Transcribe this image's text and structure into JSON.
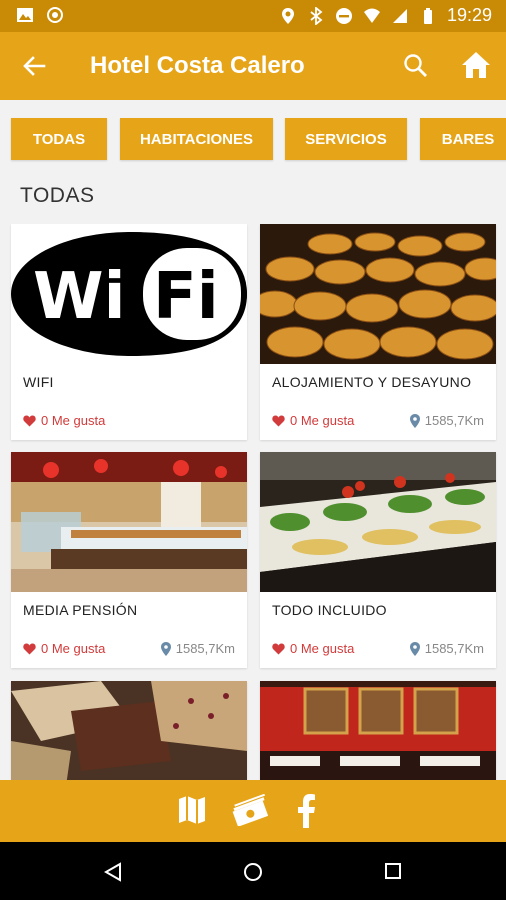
{
  "status_bar": {
    "time": "19:29"
  },
  "app_bar": {
    "title": "Hotel Costa Calero"
  },
  "tabs": [
    {
      "label": "TODAS"
    },
    {
      "label": "HABITACIONES"
    },
    {
      "label": "SERVICIOS"
    },
    {
      "label": "BARES"
    }
  ],
  "section": {
    "title": "TODAS"
  },
  "cards": [
    {
      "name": "WIFI",
      "likes": "0 Me gusta",
      "distance": ""
    },
    {
      "name": "ALOJAMIENTO Y DESAYUNO",
      "likes": "0 Me gusta",
      "distance": "1585,7Km"
    },
    {
      "name": "MEDIA PENSIÓN",
      "likes": "0 Me gusta",
      "distance": "1585,7Km"
    },
    {
      "name": "TODO INCLUIDO",
      "likes": "0 Me gusta",
      "distance": "1585,7Km"
    },
    {
      "name": "",
      "likes": "",
      "distance": ""
    },
    {
      "name": "",
      "likes": "",
      "distance": ""
    }
  ],
  "wifi_logo": {
    "text_left": "Wi",
    "text_right": "Fi"
  },
  "colors": {
    "accent": "#e6a419",
    "status_bar": "#c98a06",
    "likes": "#d23b3b"
  },
  "icons": {
    "bottom_bar": [
      "map-icon",
      "money-icon",
      "facebook-icon"
    ],
    "nav": [
      "back-triangle-icon",
      "home-circle-icon",
      "recents-square-icon"
    ]
  }
}
